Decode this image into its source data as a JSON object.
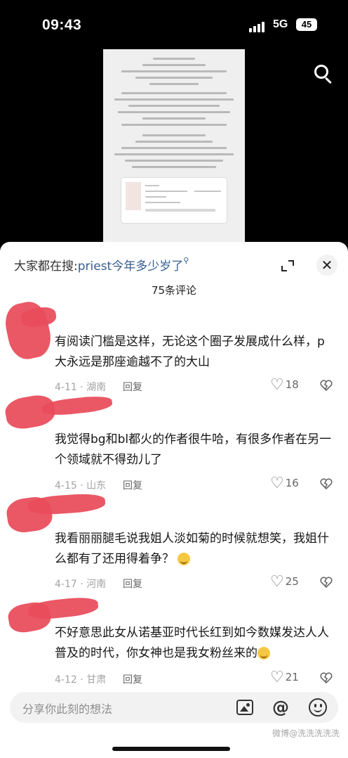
{
  "status_bar": {
    "time": "09:43",
    "network": "5G",
    "battery": "45"
  },
  "background_video": {
    "search_icon": "search-icon"
  },
  "sheet": {
    "suggestion_prefix": "大家都在搜:",
    "suggestion_keyword": "priest今年多少岁了",
    "comment_count": "75条评论",
    "icons": {
      "expand": "expand-icon",
      "close": "close-icon"
    },
    "close_symbol": "✕"
  },
  "comments": [
    {
      "text": "有阅读门槛是这样，无论这个圈子发展成什么样，p大永远是那座逾越不了的大山",
      "date": "4-11",
      "location": "湖南",
      "reply": "回复",
      "likes": "18"
    },
    {
      "text": "我觉得bg和bl都火的作者很牛哈，有很多作者在另一个领域就不得劲儿了",
      "date": "4-15",
      "location": "山东",
      "reply": "回复",
      "likes": "16"
    },
    {
      "text": "我看丽丽腿毛说我姐人淡如菊的时候就想笑，我姐什么都有了还用得着争？",
      "date": "4-17",
      "location": "河南",
      "reply": "回复",
      "likes": "25"
    },
    {
      "text": "不好意思此女从诺基亚时代长红到如今数媒发达人人普及的时代，你女神也是我女粉丝来的",
      "date": "4-12",
      "location": "甘肃",
      "reply": "回复",
      "likes": "21"
    }
  ],
  "meta_separator": " · ",
  "input": {
    "placeholder": "分享你此刻的想法",
    "icons": [
      "image-icon",
      "at-icon",
      "emoji-icon"
    ],
    "at_symbol": "@"
  },
  "watermark": "微博@洗洗洗洗洗"
}
